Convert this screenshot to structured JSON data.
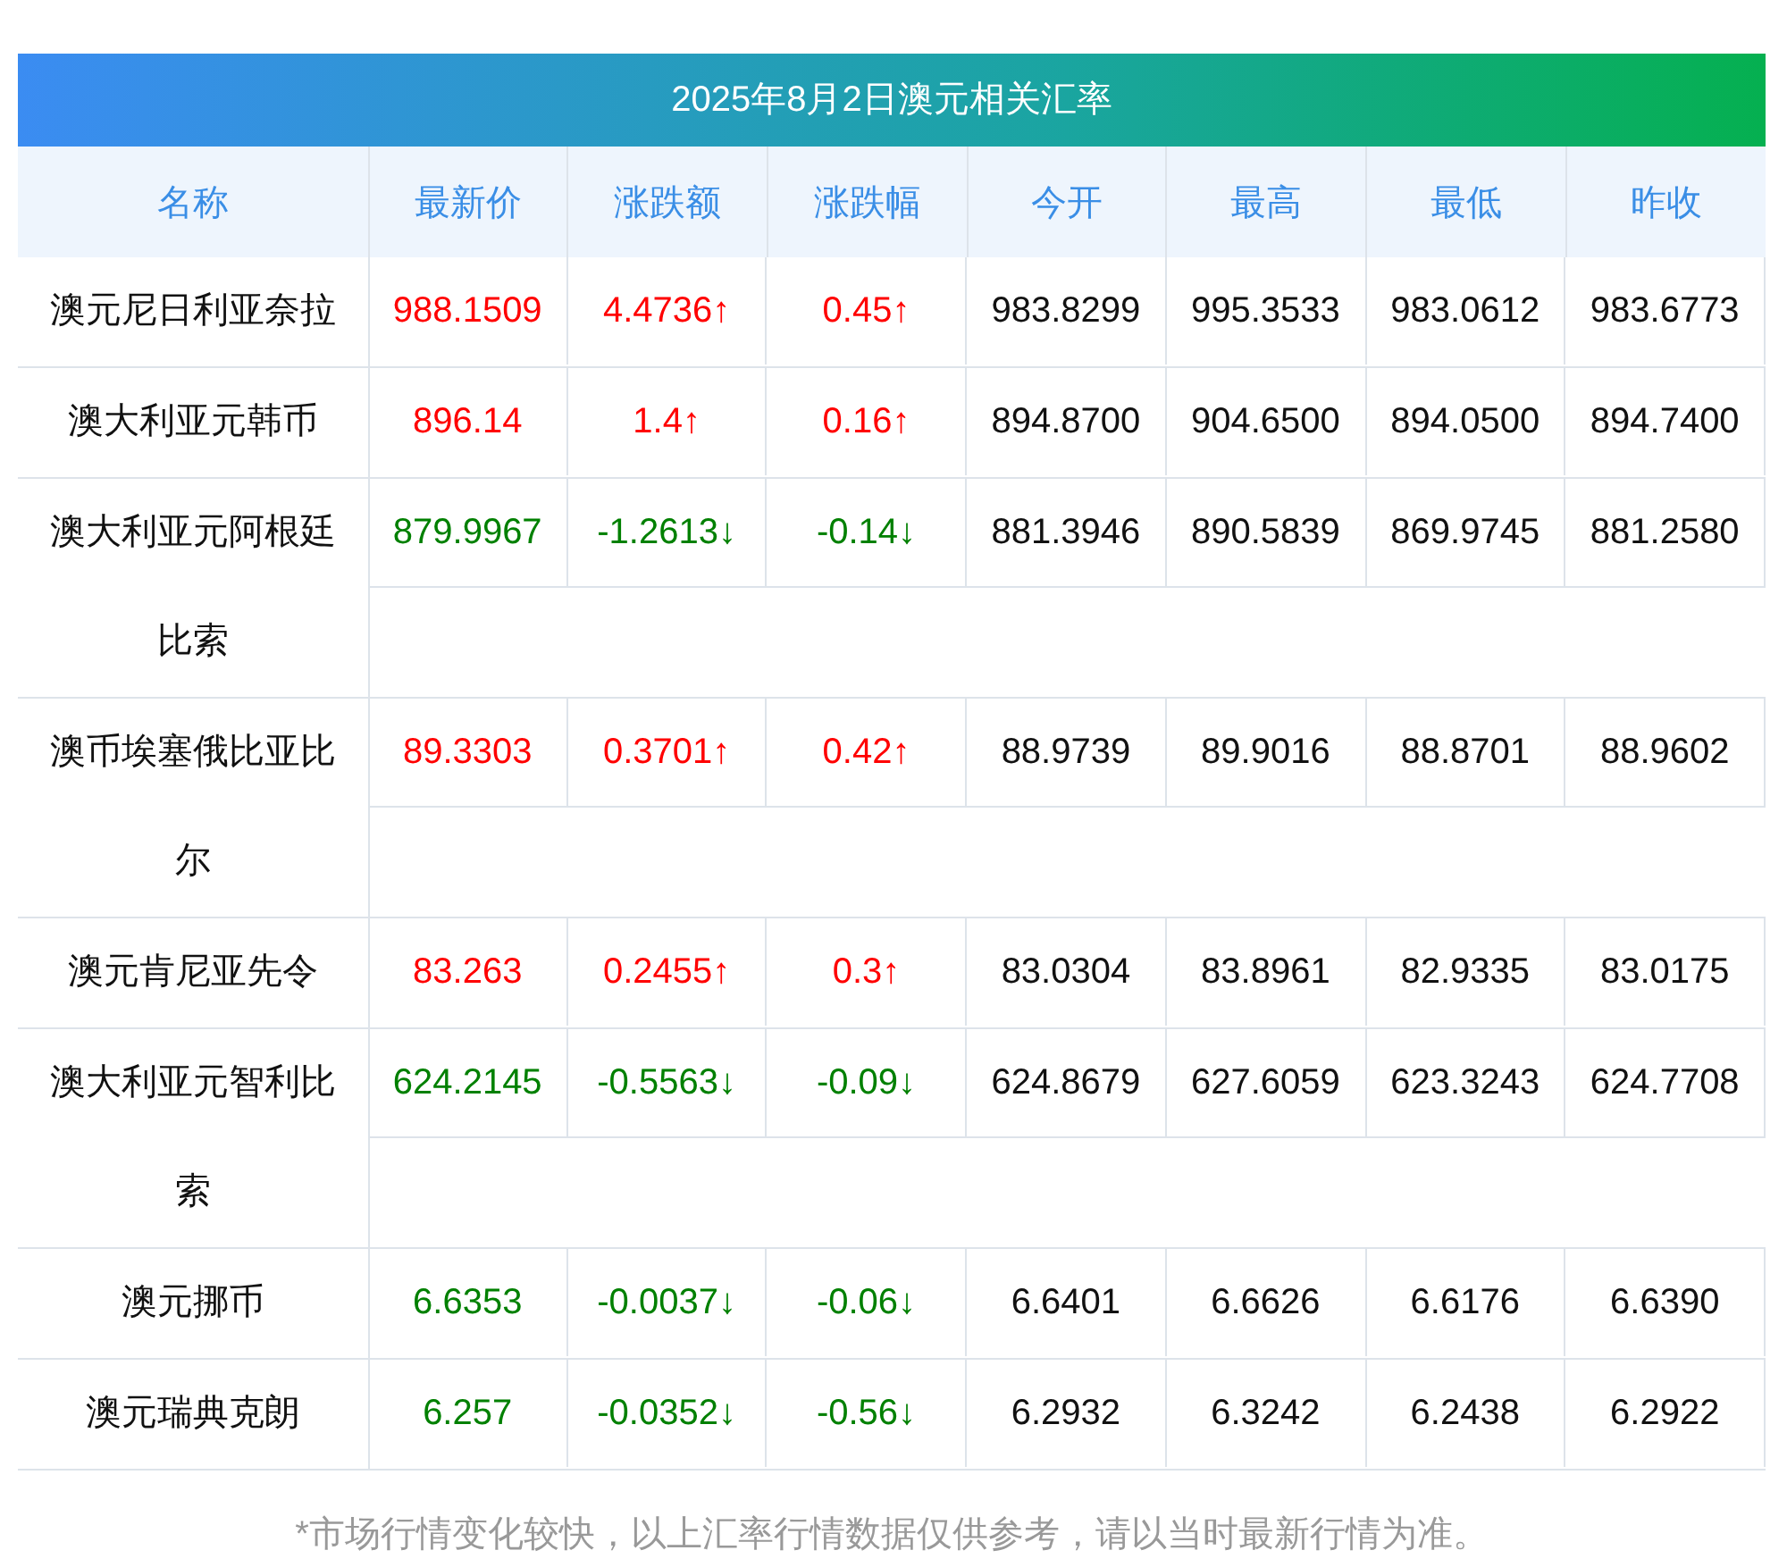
{
  "title": "2025年8月2日澳元相关汇率",
  "columns": [
    "名称",
    "最新价",
    "涨跌额",
    "涨跌幅",
    "今开",
    "最高",
    "最低",
    "昨收"
  ],
  "rows": [
    {
      "name": "澳元尼日利亚奈拉",
      "color": "#ff0000",
      "cells": [
        "988.1509",
        "4.4736↑",
        "0.45↑",
        "983.8299",
        "995.3533",
        "983.0612",
        "983.6773"
      ]
    },
    {
      "name": "澳大利亚元韩币",
      "color": "#ff0000",
      "cells": [
        "896.14",
        "1.4↑",
        "0.16↑",
        "894.8700",
        "904.6500",
        "894.0500",
        "894.7400"
      ]
    },
    {
      "name": "澳大利亚元阿根廷比索",
      "color": "#008000",
      "cells": [
        "879.9967",
        "-1.2613↓",
        "-0.14↓",
        "881.3946",
        "890.5839",
        "869.9745",
        "881.2580"
      ]
    },
    {
      "name": "澳币埃塞俄比亚比尔",
      "color": "#ff0000",
      "cells": [
        "89.3303",
        "0.3701↑",
        "0.42↑",
        "88.9739",
        "89.9016",
        "88.8701",
        "88.9602"
      ]
    },
    {
      "name": "澳元肯尼亚先令",
      "color": "#ff0000",
      "cells": [
        "83.263",
        "0.2455↑",
        "0.3↑",
        "83.0304",
        "83.8961",
        "82.9335",
        "83.0175"
      ]
    },
    {
      "name": "澳大利亚元智利比索",
      "color": "#008000",
      "cells": [
        "624.2145",
        "-0.5563↓",
        "-0.09↓",
        "624.8679",
        "627.6059",
        "623.3243",
        "624.7708"
      ]
    },
    {
      "name": "澳元挪币",
      "color": "#008000",
      "cells": [
        "6.6353",
        "-0.0037↓",
        "-0.06↓",
        "6.6401",
        "6.6626",
        "6.6176",
        "6.6390"
      ]
    },
    {
      "name": "澳元瑞典克朗",
      "color": "#008000",
      "cells": [
        "6.257",
        "-0.0352↓",
        "-0.56↓",
        "6.2932",
        "6.3242",
        "6.2438",
        "6.2922"
      ]
    }
  ],
  "note": "*市场行情变化较快，以上汇率行情数据仅供参考，请以当时最新行情为准。"
}
